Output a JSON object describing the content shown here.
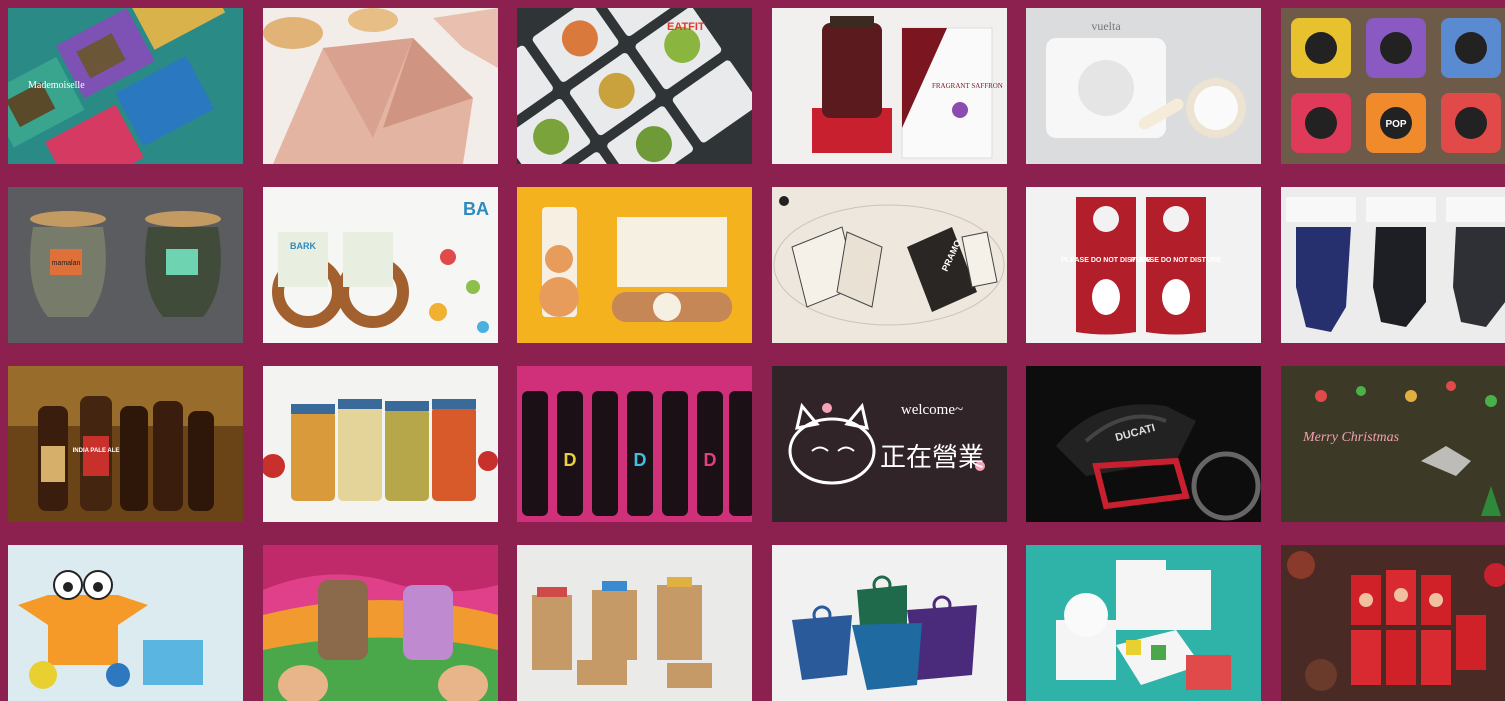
{
  "tiles": [
    {
      "row": 1,
      "col": 1,
      "name": "teapack-boxes",
      "text": "Mademoiselle"
    },
    {
      "row": 1,
      "col": 2,
      "name": "pink-folded-box",
      "text": ""
    },
    {
      "row": 1,
      "col": 3,
      "name": "salad-trays",
      "text": "EATFIT"
    },
    {
      "row": 1,
      "col": 4,
      "name": "saffron-jar",
      "text": "FRAGRANT SAFFRON"
    },
    {
      "row": 1,
      "col": 5,
      "name": "white-cutout-pack",
      "text": "vuelta"
    },
    {
      "row": 1,
      "col": 6,
      "name": "popcorn-cups",
      "text": "POP"
    },
    {
      "row": 2,
      "col": 1,
      "name": "tea-jars",
      "text": "mamalan"
    },
    {
      "row": 2,
      "col": 2,
      "name": "pretzel-pack",
      "text": "BARK"
    },
    {
      "row": 2,
      "col": 3,
      "name": "yellow-bone-pack",
      "text": ""
    },
    {
      "row": 2,
      "col": 4,
      "name": "hang-tags",
      "text": "PRAMO"
    },
    {
      "row": 2,
      "col": 5,
      "name": "door-hangers",
      "text": "PLEASE DO NOT DISTURB"
    },
    {
      "row": 2,
      "col": 6,
      "name": "glove-tags",
      "text": ""
    },
    {
      "row": 3,
      "col": 1,
      "name": "beer-bottles",
      "text": "INDIA PALE ALE"
    },
    {
      "row": 3,
      "col": 2,
      "name": "sauce-jars",
      "text": ""
    },
    {
      "row": 3,
      "col": 3,
      "name": "wine-bottles",
      "text": "D"
    },
    {
      "row": 3,
      "col": 4,
      "name": "welcome-cat-sign",
      "text": "welcome~"
    },
    {
      "row": 3,
      "col": 4,
      "name": "welcome-cat-sign-chinese",
      "text": "正在營業"
    },
    {
      "row": 3,
      "col": 5,
      "name": "ducati-motorcycle",
      "text": "DUCATI"
    },
    {
      "row": 3,
      "col": 6,
      "name": "christmas-window",
      "text": "Merry Christmas"
    },
    {
      "row": 4,
      "col": 1,
      "name": "crab-box",
      "text": ""
    },
    {
      "row": 4,
      "col": 2,
      "name": "paper-puppets",
      "text": ""
    },
    {
      "row": 4,
      "col": 3,
      "name": "kraft-boxes",
      "text": ""
    },
    {
      "row": 4,
      "col": 4,
      "name": "cup-boxes",
      "text": ""
    },
    {
      "row": 4,
      "col": 5,
      "name": "cups-fries",
      "text": ""
    },
    {
      "row": 4,
      "col": 6,
      "name": "red-envelopes",
      "text": ""
    }
  ]
}
